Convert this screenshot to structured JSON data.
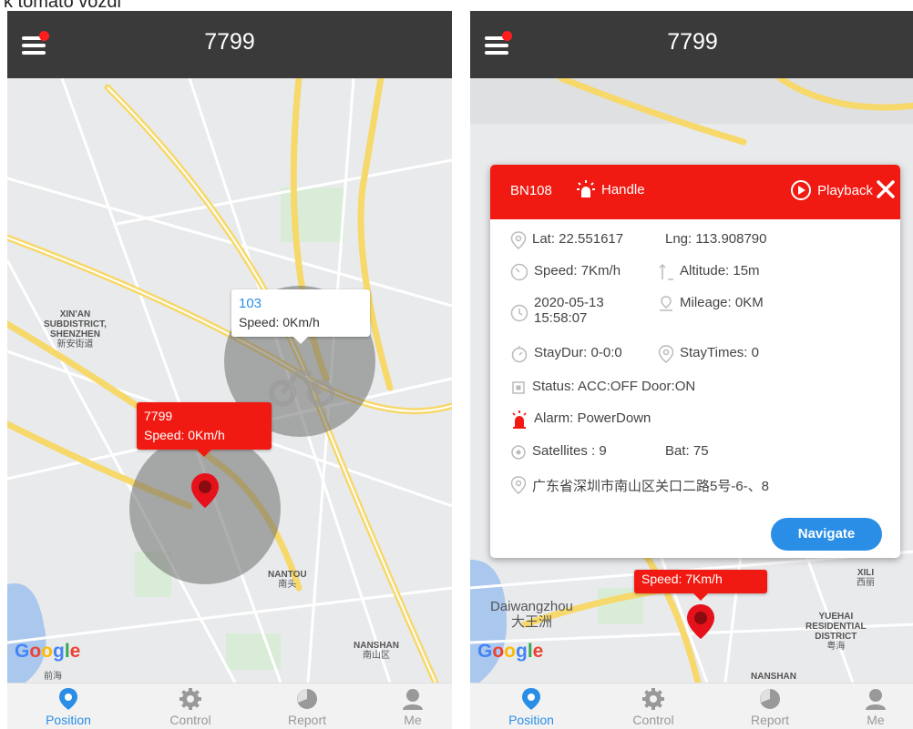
{
  "caption": "k tomato vozdi",
  "left": {
    "title": "7799",
    "places": {
      "xinan": [
        "XIN'AN",
        "SUBDISTRICT,",
        "SHENZHEN"
      ],
      "xinan_cn": "新安街道",
      "nantou": "NANTOU",
      "nantou_cn": "南头",
      "nanshan": "NANSHAN",
      "nanshan_cn": "南山区",
      "bottom_cn": "前海"
    },
    "bubble_103": {
      "name": "103",
      "speed": "Speed: 0Km/h"
    },
    "bubble_7799": {
      "name": "7799",
      "speed": "Speed: 0Km/h"
    }
  },
  "right": {
    "title": "7799",
    "popup": {
      "device": "BN108",
      "handle": "Handle",
      "playback": "Playback",
      "lat": "Lat: 22.551617",
      "lng": "Lng: 113.908790",
      "speed": "Speed: 7Km/h",
      "altitude": "Altitude: 15m",
      "datetime_date": "2020-05-13",
      "datetime_time": "15:58:07",
      "mileage": "Mileage: 0KM",
      "staydur": "StayDur: 0-0:0",
      "staytimes": "StayTimes: 0",
      "status": "Status: ACC:OFF Door:ON",
      "alarm": "Alarm: PowerDown",
      "satellites": "Satellites : 9",
      "bat": "Bat: 75",
      "address": "广东省深圳市南山区关口二路5号-6-、8",
      "navigate": "Navigate"
    },
    "places": {
      "daiwangzhou": "Daiwangzhou",
      "daiwangzhou_cn": "大王洲",
      "yuehai": [
        "YUEHAI",
        "RESIDENTIAL",
        "DISTRICT"
      ],
      "yuehai_cn": "粤海",
      "xili": "XILI",
      "xili_cn": "西丽",
      "nanshan": "NANSHAN"
    },
    "bubble_speed": "Speed: 7Km/h"
  },
  "google": [
    "G",
    "o",
    "o",
    "g",
    "l",
    "e"
  ],
  "nav": [
    {
      "label": "Position",
      "icon": "location-pin-icon",
      "active": true
    },
    {
      "label": "Control",
      "icon": "gear-icon",
      "active": false
    },
    {
      "label": "Report",
      "icon": "pie-chart-icon",
      "active": false
    },
    {
      "label": "Me",
      "icon": "person-icon",
      "active": false
    }
  ],
  "colors": {
    "topbar": "#3a3a3a",
    "accent_red": "#f01a12",
    "accent_blue": "#2a8ee6",
    "road_yellow": "#f7d86b"
  }
}
